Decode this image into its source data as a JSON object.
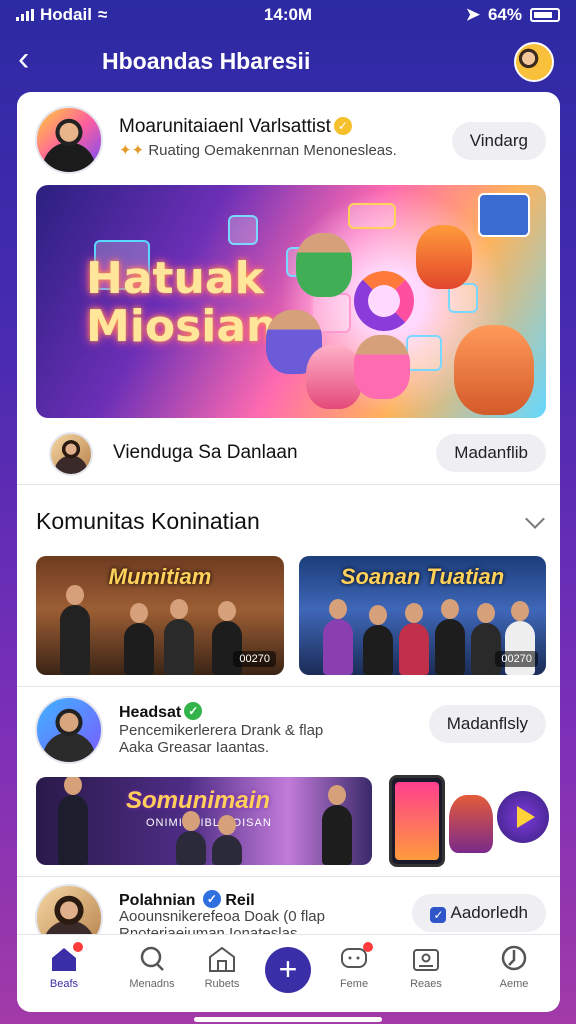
{
  "status_bar": {
    "carrier": "Hodail",
    "time": "14:0M",
    "battery": "64%"
  },
  "header": {
    "title": "Hboandas Hbaresii"
  },
  "post1": {
    "name": "Moarunitaiaenl Varlsattist",
    "subtitle": "Ruating Oemakenrnan Menonesleas.",
    "button": "Vindarg"
  },
  "hero": {
    "line1": "Hatuak",
    "line2": "Miosian"
  },
  "creator_row": {
    "name": "Vienduga Sa Danlaan",
    "button": "Madanflib"
  },
  "section": {
    "title": "Komunitas Koninatian"
  },
  "thumbnails": [
    {
      "title": "Mumitiam",
      "badge": "00270"
    },
    {
      "title": "Soanan Tuatian",
      "badge": "00270"
    }
  ],
  "post2": {
    "name": "Headsat",
    "subtitle_line1": "Pencemikerlerera Drank & flap",
    "subtitle_line2": "Aaka Greasar Iaantas.",
    "button": "Madanflsly"
  },
  "banner": {
    "title": "Somunimain",
    "sub": "ONIMIOI IBL NOISAN"
  },
  "post3": {
    "name": "Polahnian",
    "badge_text": "Reil",
    "subtitle_line1": "Aoounsnikerefeoa Doak (0 flap",
    "subtitle_line2": "Rnoteriaeiuman Ionateslas",
    "button": "Aadorledh"
  },
  "tabs": [
    {
      "label": "Beafs",
      "icon": "home-icon",
      "active": true
    },
    {
      "label": "Menadns",
      "icon": "search-icon",
      "active": false
    },
    {
      "label": "Rubets",
      "icon": "store-icon",
      "active": false
    },
    {
      "label": "Feme",
      "icon": "chat-icon",
      "active": false
    },
    {
      "label": "Reaes",
      "icon": "profile-card-icon",
      "active": false
    },
    {
      "label": "Aeme",
      "icon": "explore-icon",
      "active": false
    }
  ],
  "colors": {
    "primary": "#3b2fa8",
    "background_top": "#2c2aa3",
    "background_bottom": "#a23aa8"
  }
}
